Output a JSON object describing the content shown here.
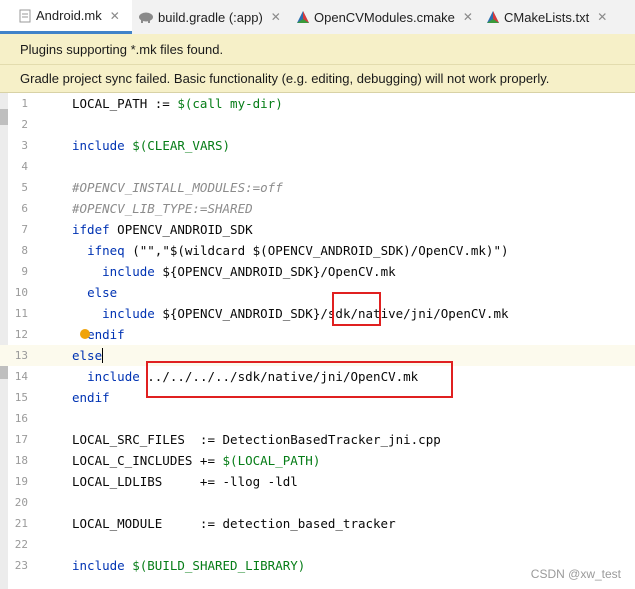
{
  "tabs": [
    {
      "label": "Android.mk",
      "icon": "mk-file-icon",
      "active": true,
      "closable": true
    },
    {
      "label": "build.gradle (:app)",
      "icon": "gradle-elephant-icon",
      "active": false,
      "closable": true
    },
    {
      "label": "OpenCVModules.cmake",
      "icon": "cmake-triangle-icon",
      "active": false,
      "closable": true
    },
    {
      "label": "CMakeLists.txt",
      "icon": "cmake-triangle-icon",
      "active": false,
      "closable": true
    }
  ],
  "notifications": {
    "plugins": "Plugins supporting *.mk files found.",
    "gradle_sync": "Gradle project sync failed. Basic functionality (e.g. editing, debugging) will not work properly."
  },
  "editor": {
    "current_line": 13,
    "lines": [
      {
        "num": "1",
        "text": "LOCAL_PATH := $(call my-dir)"
      },
      {
        "num": "2",
        "text": ""
      },
      {
        "num": "3",
        "text": "include $(CLEAR_VARS)"
      },
      {
        "num": "4",
        "text": ""
      },
      {
        "num": "5",
        "text": "#OPENCV_INSTALL_MODULES:=off"
      },
      {
        "num": "6",
        "text": "#OPENCV_LIB_TYPE:=SHARED"
      },
      {
        "num": "7",
        "text": "ifdef OPENCV_ANDROID_SDK"
      },
      {
        "num": "8",
        "text": "  ifneq (\"\",\"$(wildcard $(OPENCV_ANDROID_SDK)/OpenCV.mk)\")"
      },
      {
        "num": "9",
        "text": "    include ${OPENCV_ANDROID_SDK}/OpenCV.mk"
      },
      {
        "num": "10",
        "text": "  else"
      },
      {
        "num": "11",
        "text": "    include ${OPENCV_ANDROID_SDK}/sdk/native/jni/OpenCV.mk"
      },
      {
        "num": "12",
        "text": "  endif"
      },
      {
        "num": "13",
        "text": "else"
      },
      {
        "num": "14",
        "text": "  include ../../../../sdk/native/jni/OpenCV.mk"
      },
      {
        "num": "15",
        "text": "endif"
      },
      {
        "num": "16",
        "text": ""
      },
      {
        "num": "17",
        "text": "LOCAL_SRC_FILES  := DetectionBasedTracker_jni.cpp"
      },
      {
        "num": "18",
        "text": "LOCAL_C_INCLUDES += $(LOCAL_PATH)"
      },
      {
        "num": "19",
        "text": "LOCAL_LDLIBS     += -llog -ldl"
      },
      {
        "num": "20",
        "text": ""
      },
      {
        "num": "21",
        "text": "LOCAL_MODULE     := detection_based_tracker"
      },
      {
        "num": "22",
        "text": ""
      },
      {
        "num": "23",
        "text": "include $(BUILD_SHARED_LIBRARY)"
      }
    ]
  },
  "watermark": "CSDN @xw_test",
  "colors": {
    "keyword": "#0033b3",
    "variable": "#067d17",
    "comment": "#8c8c8c",
    "notification_bg": "#f6f0c8",
    "annotation_box": "#e02020",
    "active_tab_underline": "#4083c9"
  }
}
